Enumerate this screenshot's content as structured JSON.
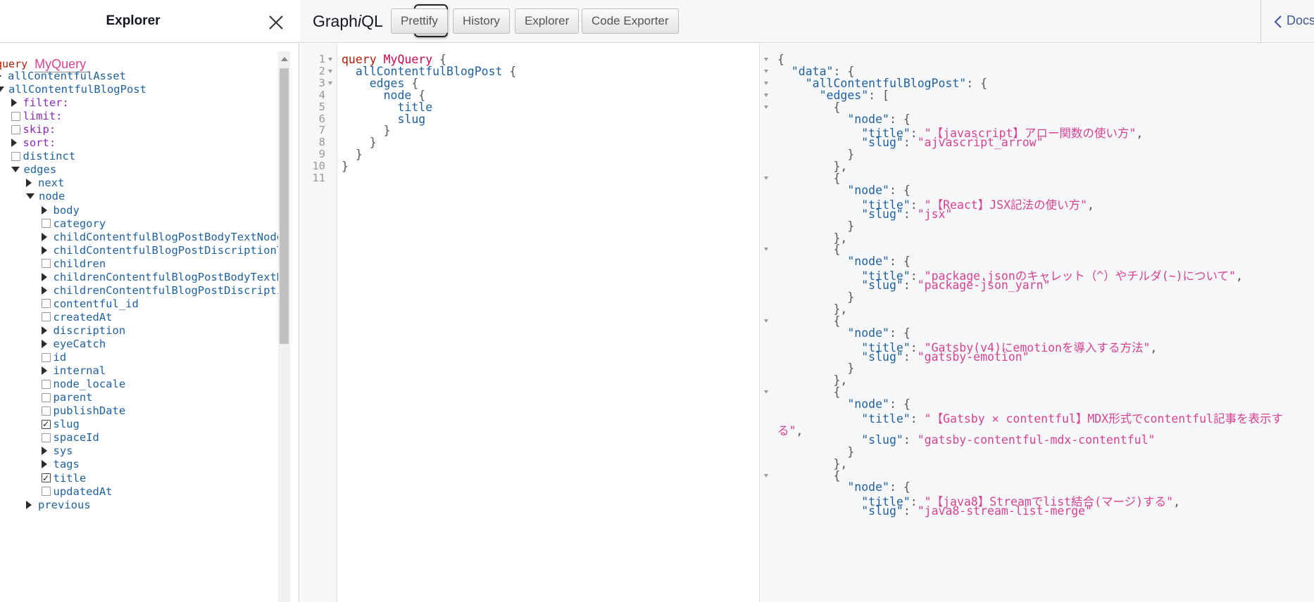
{
  "explorer": {
    "title": "Explorer",
    "operation_keyword": "query",
    "operation_name": "MyQuery",
    "tree": [
      {
        "label": "allContentfulAsset",
        "indent": 0,
        "kind": "arrow-right",
        "style": "field"
      },
      {
        "label": "allContentfulBlogPost",
        "indent": 0,
        "kind": "arrow-down",
        "style": "field"
      },
      {
        "label": "filter:",
        "indent": 1,
        "kind": "arrow-right",
        "style": "arg"
      },
      {
        "label": "limit:",
        "indent": 1,
        "kind": "checkbox",
        "style": "arg"
      },
      {
        "label": "skip:",
        "indent": 1,
        "kind": "checkbox",
        "style": "arg"
      },
      {
        "label": "sort:",
        "indent": 1,
        "kind": "arrow-right",
        "style": "arg"
      },
      {
        "label": "distinct",
        "indent": 1,
        "kind": "checkbox",
        "style": "field"
      },
      {
        "label": "edges",
        "indent": 1,
        "kind": "arrow-down",
        "style": "field"
      },
      {
        "label": "next",
        "indent": 2,
        "kind": "arrow-right",
        "style": "field"
      },
      {
        "label": "node",
        "indent": 2,
        "kind": "arrow-down",
        "style": "field"
      },
      {
        "label": "body",
        "indent": 3,
        "kind": "arrow-right",
        "style": "field"
      },
      {
        "label": "category",
        "indent": 3,
        "kind": "checkbox",
        "style": "field"
      },
      {
        "label": "childContentfulBlogPostBodyTextNode",
        "indent": 3,
        "kind": "arrow-right",
        "style": "field"
      },
      {
        "label": "childContentfulBlogPostDiscriptionTextNode",
        "indent": 3,
        "kind": "arrow-right",
        "style": "field"
      },
      {
        "label": "children",
        "indent": 3,
        "kind": "checkbox",
        "style": "field"
      },
      {
        "label": "childrenContentfulBlogPostBodyTextNode",
        "indent": 3,
        "kind": "arrow-right",
        "style": "field"
      },
      {
        "label": "childrenContentfulBlogPostDiscriptionTextNode",
        "indent": 3,
        "kind": "arrow-right",
        "style": "field"
      },
      {
        "label": "contentful_id",
        "indent": 3,
        "kind": "checkbox",
        "style": "field"
      },
      {
        "label": "createdAt",
        "indent": 3,
        "kind": "checkbox",
        "style": "field"
      },
      {
        "label": "discription",
        "indent": 3,
        "kind": "arrow-right",
        "style": "field"
      },
      {
        "label": "eyeCatch",
        "indent": 3,
        "kind": "arrow-right",
        "style": "field"
      },
      {
        "label": "id",
        "indent": 3,
        "kind": "checkbox",
        "style": "field"
      },
      {
        "label": "internal",
        "indent": 3,
        "kind": "arrow-right",
        "style": "field"
      },
      {
        "label": "node_locale",
        "indent": 3,
        "kind": "checkbox",
        "style": "field"
      },
      {
        "label": "parent",
        "indent": 3,
        "kind": "checkbox",
        "style": "field"
      },
      {
        "label": "publishDate",
        "indent": 3,
        "kind": "checkbox",
        "style": "field"
      },
      {
        "label": "slug",
        "indent": 3,
        "kind": "checkbox-checked",
        "style": "field"
      },
      {
        "label": "spaceId",
        "indent": 3,
        "kind": "checkbox",
        "style": "field"
      },
      {
        "label": "sys",
        "indent": 3,
        "kind": "arrow-right",
        "style": "field"
      },
      {
        "label": "tags",
        "indent": 3,
        "kind": "arrow-right",
        "style": "field"
      },
      {
        "label": "title",
        "indent": 3,
        "kind": "checkbox-checked",
        "style": "field"
      },
      {
        "label": "updatedAt",
        "indent": 3,
        "kind": "checkbox",
        "style": "field"
      },
      {
        "label": "previous",
        "indent": 2,
        "kind": "arrow-right",
        "style": "field"
      }
    ]
  },
  "toolbar": {
    "title_prefix": "Graph",
    "title_italic": "i",
    "title_suffix": "QL",
    "buttons": [
      "Prettify",
      "History",
      "Explorer",
      "Code Exporter"
    ],
    "docs_label": "Docs"
  },
  "query_editor": {
    "lines": [
      {
        "n": "1",
        "fold": true,
        "tokens": [
          {
            "t": "query ",
            "c": "kw"
          },
          {
            "t": "MyQuery",
            "c": "def"
          },
          {
            "t": " {",
            "c": "punc"
          }
        ]
      },
      {
        "n": "2",
        "fold": true,
        "tokens": [
          {
            "t": "  allContentfulBlogPost",
            "c": "prop"
          },
          {
            "t": " {",
            "c": "punc"
          }
        ]
      },
      {
        "n": "3",
        "fold": true,
        "tokens": [
          {
            "t": "    edges",
            "c": "prop"
          },
          {
            "t": " {",
            "c": "punc"
          }
        ]
      },
      {
        "n": "4",
        "fold": false,
        "tokens": [
          {
            "t": "      node",
            "c": "prop"
          },
          {
            "t": " {",
            "c": "punc"
          }
        ]
      },
      {
        "n": "5",
        "fold": false,
        "tokens": [
          {
            "t": "        title",
            "c": "prop"
          }
        ]
      },
      {
        "n": "6",
        "fold": false,
        "tokens": [
          {
            "t": "        slug",
            "c": "prop"
          }
        ]
      },
      {
        "n": "7",
        "fold": false,
        "tokens": [
          {
            "t": "      }",
            "c": "punc"
          }
        ]
      },
      {
        "n": "8",
        "fold": false,
        "tokens": [
          {
            "t": "    }",
            "c": "punc"
          }
        ]
      },
      {
        "n": "9",
        "fold": false,
        "tokens": [
          {
            "t": "  }",
            "c": "punc"
          }
        ]
      },
      {
        "n": "10",
        "fold": false,
        "tokens": [
          {
            "t": "}",
            "c": "punc"
          }
        ]
      },
      {
        "n": "11",
        "fold": false,
        "tokens": []
      }
    ]
  },
  "result": {
    "lines": [
      {
        "fold": true,
        "tokens": [
          {
            "t": "{",
            "c": "punc"
          }
        ]
      },
      {
        "fold": true,
        "tokens": [
          {
            "t": "  ",
            "c": "punc"
          },
          {
            "t": "\"data\"",
            "c": "rkey"
          },
          {
            "t": ": {",
            "c": "punc"
          }
        ]
      },
      {
        "fold": true,
        "tokens": [
          {
            "t": "    ",
            "c": "punc"
          },
          {
            "t": "\"allContentfulBlogPost\"",
            "c": "rkey"
          },
          {
            "t": ": {",
            "c": "punc"
          }
        ]
      },
      {
        "fold": true,
        "tokens": [
          {
            "t": "      ",
            "c": "punc"
          },
          {
            "t": "\"edges\"",
            "c": "rkey"
          },
          {
            "t": ": [",
            "c": "punc"
          }
        ]
      },
      {
        "fold": true,
        "tokens": [
          {
            "t": "        {",
            "c": "punc"
          }
        ]
      },
      {
        "fold": false,
        "tokens": [
          {
            "t": "          ",
            "c": "punc"
          },
          {
            "t": "\"node\"",
            "c": "rkey"
          },
          {
            "t": ": {",
            "c": "punc"
          }
        ]
      },
      {
        "fold": false,
        "tokens": [
          {
            "t": "            ",
            "c": "punc"
          },
          {
            "t": "\"title\"",
            "c": "rkey"
          },
          {
            "t": ": ",
            "c": "punc"
          },
          {
            "t": "\"【javascript】アロー関数の使い方\"",
            "c": "rstr"
          },
          {
            "t": ",",
            "c": "punc"
          }
        ]
      },
      {
        "fold": false,
        "tokens": [
          {
            "t": "            ",
            "c": "punc"
          },
          {
            "t": "\"slug\"",
            "c": "rkey"
          },
          {
            "t": ": ",
            "c": "punc"
          },
          {
            "t": "\"ajvascript_arrow\"",
            "c": "rstr"
          }
        ]
      },
      {
        "fold": false,
        "tokens": [
          {
            "t": "          }",
            "c": "punc"
          }
        ]
      },
      {
        "fold": false,
        "tokens": [
          {
            "t": "        },",
            "c": "punc"
          }
        ]
      },
      {
        "fold": true,
        "tokens": [
          {
            "t": "        {",
            "c": "punc"
          }
        ]
      },
      {
        "fold": false,
        "tokens": [
          {
            "t": "          ",
            "c": "punc"
          },
          {
            "t": "\"node\"",
            "c": "rkey"
          },
          {
            "t": ": {",
            "c": "punc"
          }
        ]
      },
      {
        "fold": false,
        "tokens": [
          {
            "t": "            ",
            "c": "punc"
          },
          {
            "t": "\"title\"",
            "c": "rkey"
          },
          {
            "t": ": ",
            "c": "punc"
          },
          {
            "t": "\"【React】JSX記法の使い方\"",
            "c": "rstr"
          },
          {
            "t": ",",
            "c": "punc"
          }
        ]
      },
      {
        "fold": false,
        "tokens": [
          {
            "t": "            ",
            "c": "punc"
          },
          {
            "t": "\"slug\"",
            "c": "rkey"
          },
          {
            "t": ": ",
            "c": "punc"
          },
          {
            "t": "\"jsx\"",
            "c": "rstr"
          }
        ]
      },
      {
        "fold": false,
        "tokens": [
          {
            "t": "          }",
            "c": "punc"
          }
        ]
      },
      {
        "fold": false,
        "tokens": [
          {
            "t": "        },",
            "c": "punc"
          }
        ]
      },
      {
        "fold": true,
        "tokens": [
          {
            "t": "        {",
            "c": "punc"
          }
        ]
      },
      {
        "fold": false,
        "tokens": [
          {
            "t": "          ",
            "c": "punc"
          },
          {
            "t": "\"node\"",
            "c": "rkey"
          },
          {
            "t": ": {",
            "c": "punc"
          }
        ]
      },
      {
        "fold": false,
        "tokens": [
          {
            "t": "            ",
            "c": "punc"
          },
          {
            "t": "\"title\"",
            "c": "rkey"
          },
          {
            "t": ": ",
            "c": "punc"
          },
          {
            "t": "\"package.jsonのキャレット（^）やチルダ(~)について\"",
            "c": "rstr"
          },
          {
            "t": ",",
            "c": "punc"
          }
        ]
      },
      {
        "fold": false,
        "tokens": [
          {
            "t": "            ",
            "c": "punc"
          },
          {
            "t": "\"slug\"",
            "c": "rkey"
          },
          {
            "t": ": ",
            "c": "punc"
          },
          {
            "t": "\"package-json_yarn\"",
            "c": "rstr"
          }
        ]
      },
      {
        "fold": false,
        "tokens": [
          {
            "t": "          }",
            "c": "punc"
          }
        ]
      },
      {
        "fold": false,
        "tokens": [
          {
            "t": "        },",
            "c": "punc"
          }
        ]
      },
      {
        "fold": true,
        "tokens": [
          {
            "t": "        {",
            "c": "punc"
          }
        ]
      },
      {
        "fold": false,
        "tokens": [
          {
            "t": "          ",
            "c": "punc"
          },
          {
            "t": "\"node\"",
            "c": "rkey"
          },
          {
            "t": ": {",
            "c": "punc"
          }
        ]
      },
      {
        "fold": false,
        "tokens": [
          {
            "t": "            ",
            "c": "punc"
          },
          {
            "t": "\"title\"",
            "c": "rkey"
          },
          {
            "t": ": ",
            "c": "punc"
          },
          {
            "t": "\"Gatsby(v4)にemotionを導入する方法\"",
            "c": "rstr"
          },
          {
            "t": ",",
            "c": "punc"
          }
        ]
      },
      {
        "fold": false,
        "tokens": [
          {
            "t": "            ",
            "c": "punc"
          },
          {
            "t": "\"slug\"",
            "c": "rkey"
          },
          {
            "t": ": ",
            "c": "punc"
          },
          {
            "t": "\"gatsby-emotion\"",
            "c": "rstr"
          }
        ]
      },
      {
        "fold": false,
        "tokens": [
          {
            "t": "          }",
            "c": "punc"
          }
        ]
      },
      {
        "fold": false,
        "tokens": [
          {
            "t": "        },",
            "c": "punc"
          }
        ]
      },
      {
        "fold": true,
        "tokens": [
          {
            "t": "        {",
            "c": "punc"
          }
        ]
      },
      {
        "fold": false,
        "tokens": [
          {
            "t": "          ",
            "c": "punc"
          },
          {
            "t": "\"node\"",
            "c": "rkey"
          },
          {
            "t": ": {",
            "c": "punc"
          }
        ]
      },
      {
        "fold": false,
        "tokens": [
          {
            "t": "            ",
            "c": "punc"
          },
          {
            "t": "\"title\"",
            "c": "rkey"
          },
          {
            "t": ": ",
            "c": "punc"
          },
          {
            "t": "\"【Gatsby × contentful】MDX形式でcontentful記事を表示す",
            "c": "rstr"
          }
        ]
      },
      {
        "fold": false,
        "tokens": [
          {
            "t": "る\"",
            "c": "rstr"
          },
          {
            "t": ",",
            "c": "punc"
          }
        ]
      },
      {
        "fold": false,
        "tokens": [
          {
            "t": "            ",
            "c": "punc"
          },
          {
            "t": "\"slug\"",
            "c": "rkey"
          },
          {
            "t": ": ",
            "c": "punc"
          },
          {
            "t": "\"gatsby-contentful-mdx-contentful\"",
            "c": "rstr"
          }
        ]
      },
      {
        "fold": false,
        "tokens": [
          {
            "t": "          }",
            "c": "punc"
          }
        ]
      },
      {
        "fold": false,
        "tokens": [
          {
            "t": "        },",
            "c": "punc"
          }
        ]
      },
      {
        "fold": true,
        "tokens": [
          {
            "t": "        {",
            "c": "punc"
          }
        ]
      },
      {
        "fold": false,
        "tokens": [
          {
            "t": "          ",
            "c": "punc"
          },
          {
            "t": "\"node\"",
            "c": "rkey"
          },
          {
            "t": ": {",
            "c": "punc"
          }
        ]
      },
      {
        "fold": false,
        "tokens": [
          {
            "t": "            ",
            "c": "punc"
          },
          {
            "t": "\"title\"",
            "c": "rkey"
          },
          {
            "t": ": ",
            "c": "punc"
          },
          {
            "t": "\"【java8】Streamでlist結合(マージ)する\"",
            "c": "rstr"
          },
          {
            "t": ",",
            "c": "punc"
          }
        ]
      },
      {
        "fold": false,
        "tokens": [
          {
            "t": "            ",
            "c": "punc"
          },
          {
            "t": "\"slug\"",
            "c": "rkey"
          },
          {
            "t": ": ",
            "c": "punc"
          },
          {
            "t": "\"java8-stream-list-merge\"",
            "c": "rstr"
          }
        ]
      }
    ]
  },
  "colors": {
    "keyword": "#b11a04",
    "definition": "#d2054e",
    "property": "#1f61a0",
    "string": "#d64292",
    "argument": "#8b2bb9"
  }
}
